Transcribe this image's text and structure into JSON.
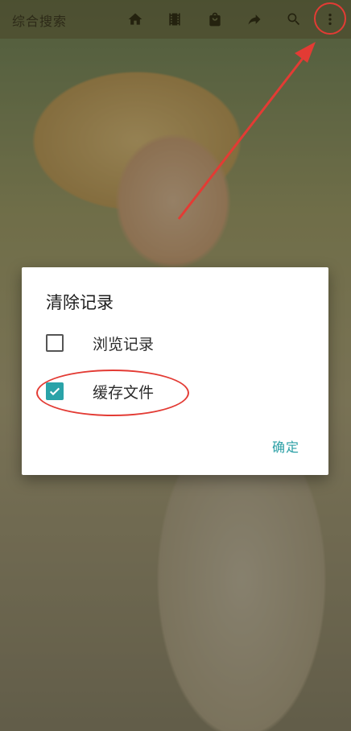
{
  "appbar": {
    "title": "综合搜索",
    "icons": [
      "home-icon",
      "film-icon",
      "bag-icon",
      "share-icon",
      "search-icon",
      "overflow-menu-icon"
    ]
  },
  "dialog": {
    "title": "清除记录",
    "options": [
      {
        "label": "浏览记录",
        "checked": false
      },
      {
        "label": "缓存文件",
        "checked": true
      }
    ],
    "confirm_label": "确定"
  },
  "colors": {
    "accent": "#2aa3a8",
    "annotation": "#e33b34"
  }
}
